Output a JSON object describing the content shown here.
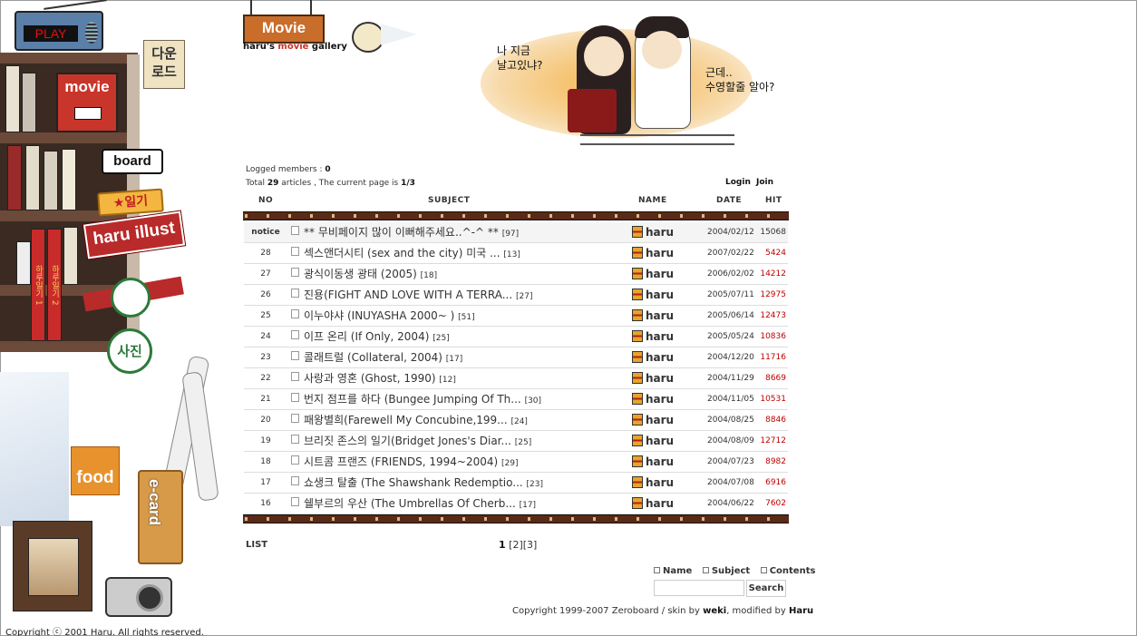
{
  "sidebar": {
    "radio_display": "PLAY",
    "download_sign": "다운\n로드",
    "movie_label": "movie",
    "board_label": "board",
    "diary_label": "★일기",
    "illust_label": "haru illust",
    "photo_label": "사진",
    "food_label": "food",
    "ecard_label": "e-card",
    "book_titles": [
      "하루일기 1",
      "하루일기 2"
    ],
    "copyright": "Copyright ⓒ 2001 Haru. All rights reserved."
  },
  "header": {
    "logo": "Movie",
    "subtitle_prefix": "haru's ",
    "subtitle_accent": "movie",
    "subtitle_suffix": " gallery",
    "bubble_left": "나 지금\n날고있냐?",
    "bubble_right": "근데..\n수영할줄 알아?"
  },
  "info": {
    "logged_label": "Logged members : ",
    "logged_value": "0",
    "total_prefix": "Total ",
    "total_value": "29",
    "total_mid": " articles , The current page is ",
    "page_value": "1/3",
    "login": "Login",
    "join": "Join"
  },
  "columns": {
    "no": "NO",
    "subject": "SUBJECT",
    "name": "NAME",
    "date": "DATE",
    "hit": "HIT"
  },
  "rows": [
    {
      "no": "notice",
      "subject": "** 무비페이지 많이 이뻐해주세요..^-^ **",
      "comments": "[97]",
      "name": "haru",
      "date": "2004/02/12",
      "hit": "15068"
    },
    {
      "no": "28",
      "subject": "섹스앤더시티 (sex and the city) 미국 ...",
      "comments": "[13]",
      "name": "haru",
      "date": "2007/02/22",
      "hit": "5424"
    },
    {
      "no": "27",
      "subject": "광식이동생 광태 (2005)",
      "comments": "[18]",
      "name": "haru",
      "date": "2006/02/02",
      "hit": "14212"
    },
    {
      "no": "26",
      "subject": "진용(FIGHT AND LOVE WITH A TERRA...",
      "comments": "[27]",
      "name": "haru",
      "date": "2005/07/11",
      "hit": "12975"
    },
    {
      "no": "25",
      "subject": "이누야샤 (INUYASHA 2000~ )",
      "comments": "[51]",
      "name": "haru",
      "date": "2005/06/14",
      "hit": "12473"
    },
    {
      "no": "24",
      "subject": "이프 온리 (If Only, 2004)",
      "comments": "[25]",
      "name": "haru",
      "date": "2005/05/24",
      "hit": "10836"
    },
    {
      "no": "23",
      "subject": "콜래트럴 (Collateral, 2004)",
      "comments": "[17]",
      "name": "haru",
      "date": "2004/12/20",
      "hit": "11716"
    },
    {
      "no": "22",
      "subject": "사랑과 영혼 (Ghost, 1990)",
      "comments": "[12]",
      "name": "haru",
      "date": "2004/11/29",
      "hit": "8669"
    },
    {
      "no": "21",
      "subject": "번지 점프를 하다 (Bungee Jumping Of Th...",
      "comments": "[30]",
      "name": "haru",
      "date": "2004/11/05",
      "hit": "10531"
    },
    {
      "no": "20",
      "subject": "패왕별희(Farewell My Concubine,199...",
      "comments": "[24]",
      "name": "haru",
      "date": "2004/08/25",
      "hit": "8846"
    },
    {
      "no": "19",
      "subject": "브리짓 존스의 일기(Bridget Jones's Diar...",
      "comments": "[25]",
      "name": "haru",
      "date": "2004/08/09",
      "hit": "12712"
    },
    {
      "no": "18",
      "subject": "시트콤 프랜즈 (FRIENDS, 1994~2004)",
      "comments": "[29]",
      "name": "haru",
      "date": "2004/07/23",
      "hit": "8982"
    },
    {
      "no": "17",
      "subject": "쇼생크 탈출 (The Shawshank Redemptio...",
      "comments": "[23]",
      "name": "haru",
      "date": "2004/07/08",
      "hit": "6916"
    },
    {
      "no": "16",
      "subject": "쉘부르의 우산 (The Umbrellas Of Cherb...",
      "comments": "[17]",
      "name": "haru",
      "date": "2004/06/22",
      "hit": "7602"
    }
  ],
  "footer": {
    "list": "LIST",
    "pages": [
      "1",
      "[2]",
      "[3]"
    ],
    "search_options": [
      "Name",
      "Subject",
      "Contents"
    ],
    "search_button": "Search",
    "copy_prefix": "Copyright 1999-2007 Zeroboard / skin by ",
    "copy_weki": "weki",
    "copy_mid": ", modified by ",
    "copy_haru": "Haru"
  },
  "colors": {
    "hit_red": "#c00000",
    "film_brown": "#5a2a16",
    "logo_orange": "#c86d2a"
  },
  "icons": {
    "post": "document-icon",
    "author": "user-badge-icon"
  }
}
